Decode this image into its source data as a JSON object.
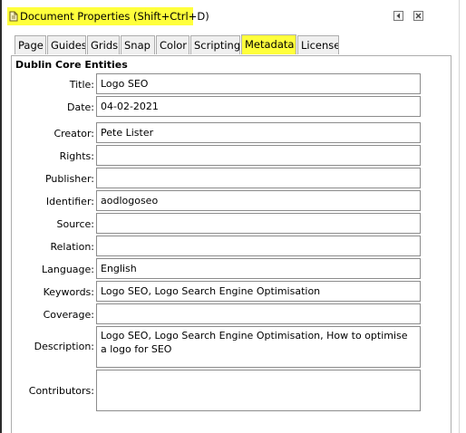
{
  "window": {
    "title": "Document Properties (Shift+Ctrl+D)",
    "icon": "document-properties-icon",
    "highlight_color": "#ffff3c"
  },
  "tabs": [
    {
      "label": "Page",
      "active": false
    },
    {
      "label": "Guides",
      "active": false
    },
    {
      "label": "Grids",
      "active": false
    },
    {
      "label": "Snap",
      "active": false
    },
    {
      "label": "Color",
      "active": false
    },
    {
      "label": "Scripting",
      "active": false
    },
    {
      "label": "Metadata",
      "active": true
    },
    {
      "label": "License",
      "active": false
    }
  ],
  "section_title": "Dublin Core Entities",
  "fields": {
    "title": {
      "label": "Title:",
      "value": "Logo SEO"
    },
    "date": {
      "label": "Date:",
      "value": "04-02-2021"
    },
    "creator": {
      "label": "Creator:",
      "value": "Pete Lister"
    },
    "rights": {
      "label": "Rights:",
      "value": ""
    },
    "publisher": {
      "label": "Publisher:",
      "value": ""
    },
    "identifier": {
      "label": "Identifier:",
      "value": "aodlogoseo"
    },
    "source": {
      "label": "Source:",
      "value": ""
    },
    "relation": {
      "label": "Relation:",
      "value": ""
    },
    "language": {
      "label": "Language:",
      "value": "English"
    },
    "keywords": {
      "label": "Keywords:",
      "value": "Logo SEO, Logo Search Engine Optimisation"
    },
    "coverage": {
      "label": "Coverage:",
      "value": ""
    },
    "description": {
      "label": "Description:",
      "value": "Logo SEO, Logo Search Engine Optimisation, How to optimise a logo for SEO"
    },
    "contributors": {
      "label": "Contributors:",
      "value": ""
    }
  }
}
